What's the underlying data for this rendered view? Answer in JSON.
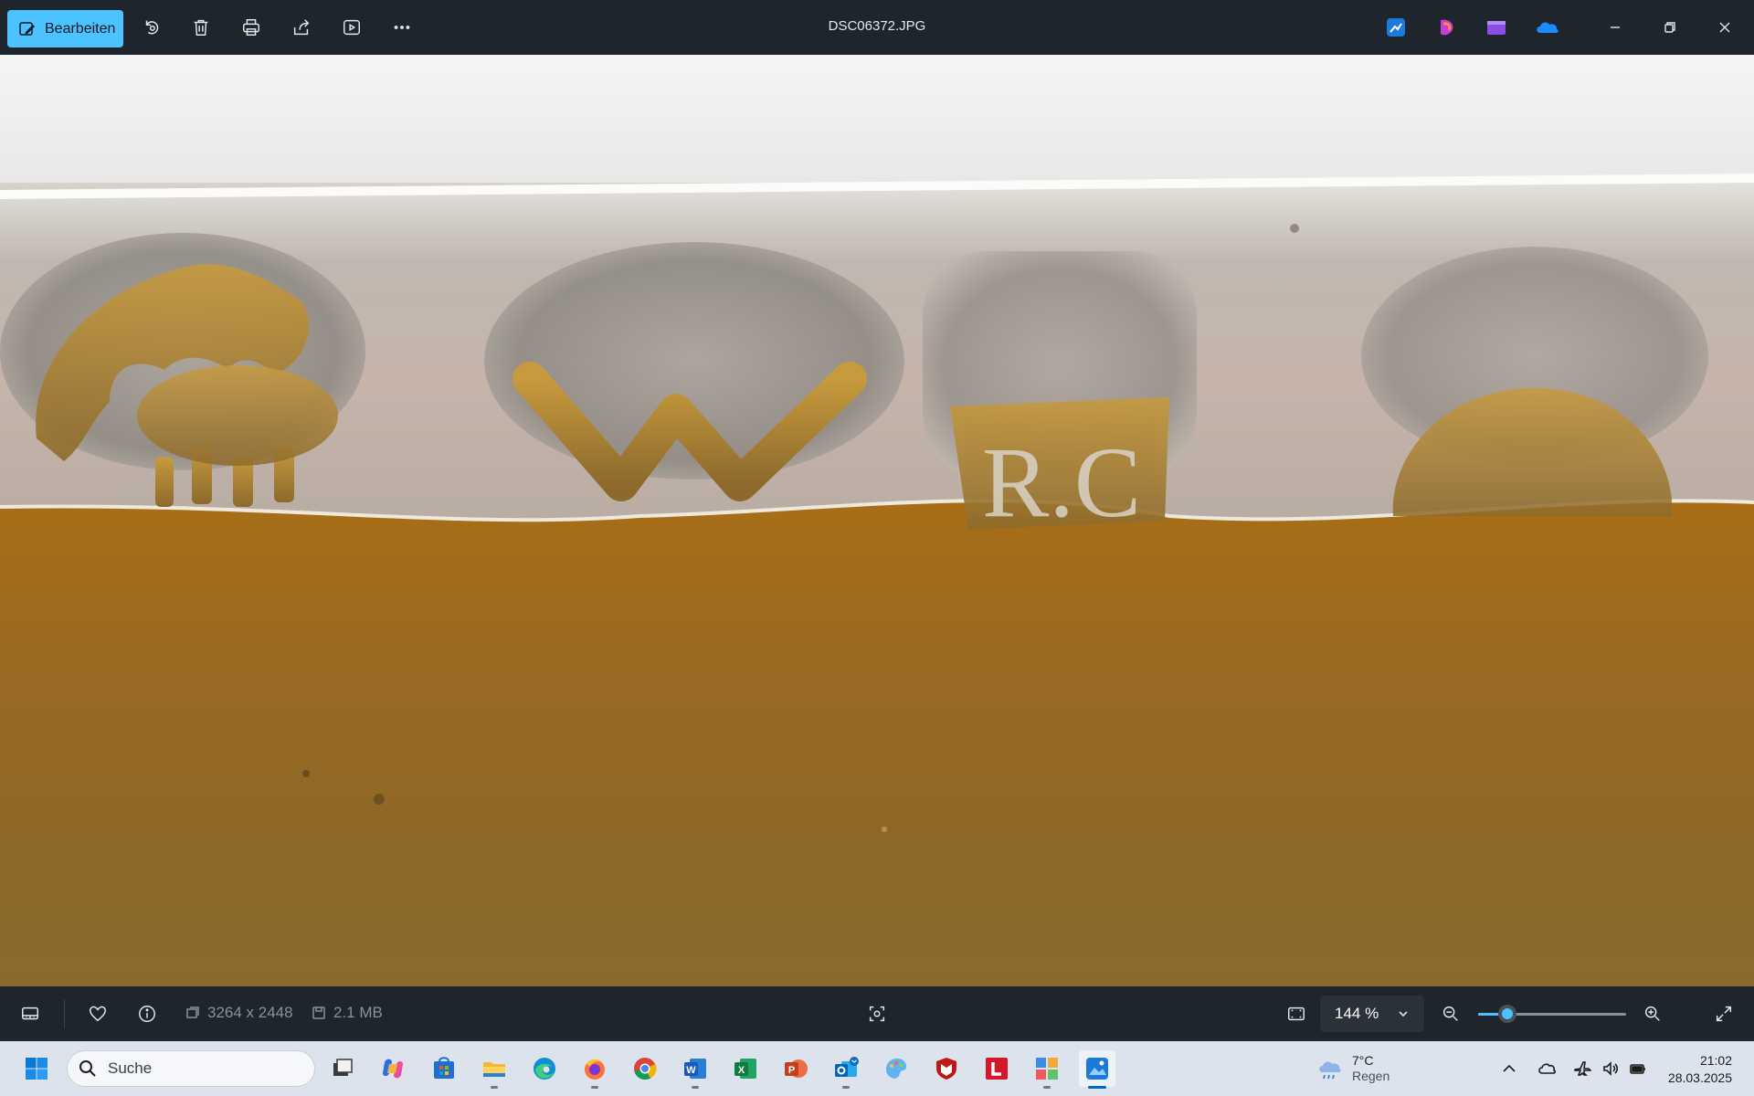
{
  "toolbar": {
    "edit_label": "Bearbeiten",
    "file_name": "DSC06372.JPG",
    "icons": [
      "rotate-icon",
      "delete-icon",
      "print-icon",
      "share-icon",
      "slideshow-icon",
      "more-icon"
    ],
    "apps": [
      "designer-icon",
      "clipchamp-icon",
      "video-editor-icon",
      "onedrive-icon"
    ],
    "colors": {
      "accent": "#4cc2ff",
      "bar": "#1e252d"
    }
  },
  "photo": {
    "subject": "hallmarks on silver edge",
    "stamp_text": [
      "W",
      "R.C"
    ]
  },
  "viewer": {
    "dimensions": "3264 x 2448",
    "file_size": "2.1 MB",
    "zoom": "144 %",
    "zoom_level_percent": 144,
    "slider_fraction": 0.2
  },
  "taskbar": {
    "search_placeholder": "Suche",
    "apps": [
      "start",
      "task-view",
      "copilot",
      "store",
      "file-explorer",
      "edge",
      "firefox",
      "chrome",
      "word",
      "excel",
      "powerpoint",
      "outlook",
      "paint",
      "mcafee",
      "lexware",
      "snipping",
      "photos"
    ],
    "weather": {
      "temp": "7°C",
      "condition": "Regen"
    },
    "clock": {
      "time": "21:02",
      "date": "28.03.2025"
    }
  }
}
